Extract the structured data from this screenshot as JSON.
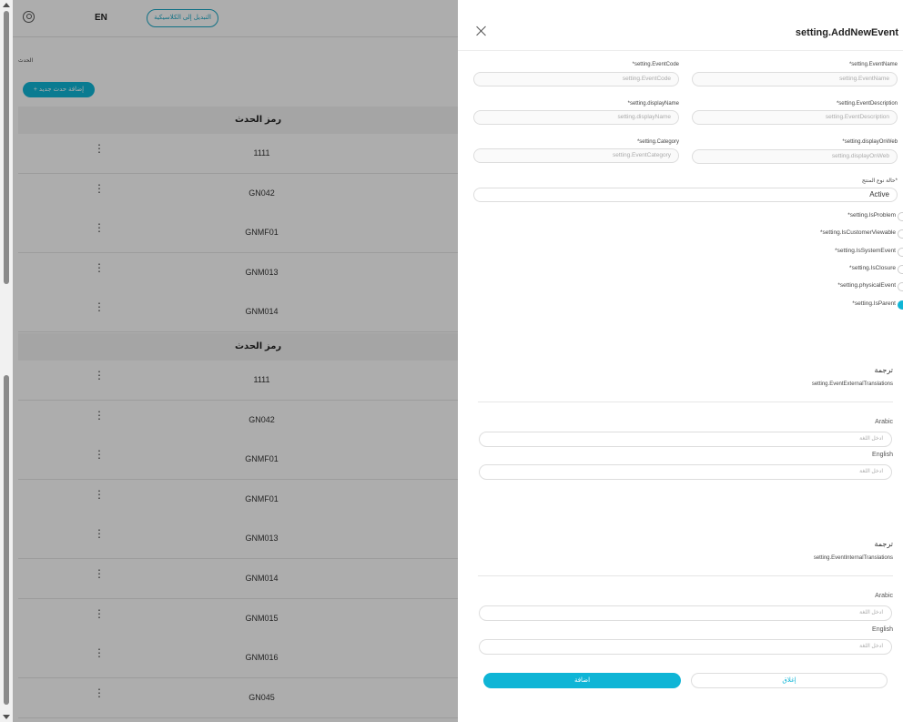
{
  "topbar": {
    "language": "EN",
    "switch_label": "التبديل إلى الكلاسيكية"
  },
  "breadcrumb": "الحدث",
  "add_event_label": "+ إضافة حدث جديد",
  "table": {
    "header": "رمز الحدث",
    "group1": [
      "1111",
      "GN042",
      "GNMF01",
      "GNM013",
      "GNM014"
    ],
    "group2": [
      "1111",
      "GN042",
      "GNMF01",
      "GNMF01",
      "GNM013",
      "GNM014",
      "GNM015",
      "GNM016",
      "GN045"
    ]
  },
  "panel": {
    "title": "setting.AddNewEvent",
    "fields": {
      "event_code": {
        "label": "*setting.EventCode",
        "placeholder": "setting.EventCode"
      },
      "event_name": {
        "label": "*setting.EventName",
        "placeholder": "setting.EventName"
      },
      "display_name": {
        "label": "*setting.displayName",
        "placeholder": "setting.displayName"
      },
      "event_description": {
        "label": "*setting.EventDescription",
        "placeholder": "setting.EventDescription"
      },
      "category": {
        "label": "*setting.Category",
        "placeholder": "setting.EventCategory"
      },
      "display_on_web": {
        "label": "*setting.displayOnWeb",
        "placeholder": "setting.displayOnWeb"
      },
      "product_status": {
        "label": "حالة نوع المنتج*",
        "value": "Active"
      }
    },
    "checks": [
      {
        "label": "*setting.IsProblem",
        "on": false
      },
      {
        "label": "*setting.IsCustomerViewable",
        "on": false
      },
      {
        "label": "*setting.IsSystemEvent",
        "on": false
      },
      {
        "label": "*setting.IsClosure",
        "on": false
      },
      {
        "label": "*setting.physicalEvent",
        "on": false
      },
      {
        "label": "*setting.IsParent",
        "on": true
      }
    ],
    "external": {
      "title": "ترجمة",
      "subtitle": "setting.EventExternalTranslations",
      "arabic_label": "Arabic",
      "english_label": "English",
      "placeholder": "ادخل اللغة"
    },
    "internal": {
      "title": "ترجمة",
      "subtitle": "setting.EventInternalTranslations",
      "arabic_label": "Arabic",
      "english_label": "English",
      "placeholder": "ادخل اللغة"
    },
    "save_label": "اضافة",
    "cancel_label": "إغلاق"
  },
  "colors": {
    "accent": "#0fb5d6"
  }
}
